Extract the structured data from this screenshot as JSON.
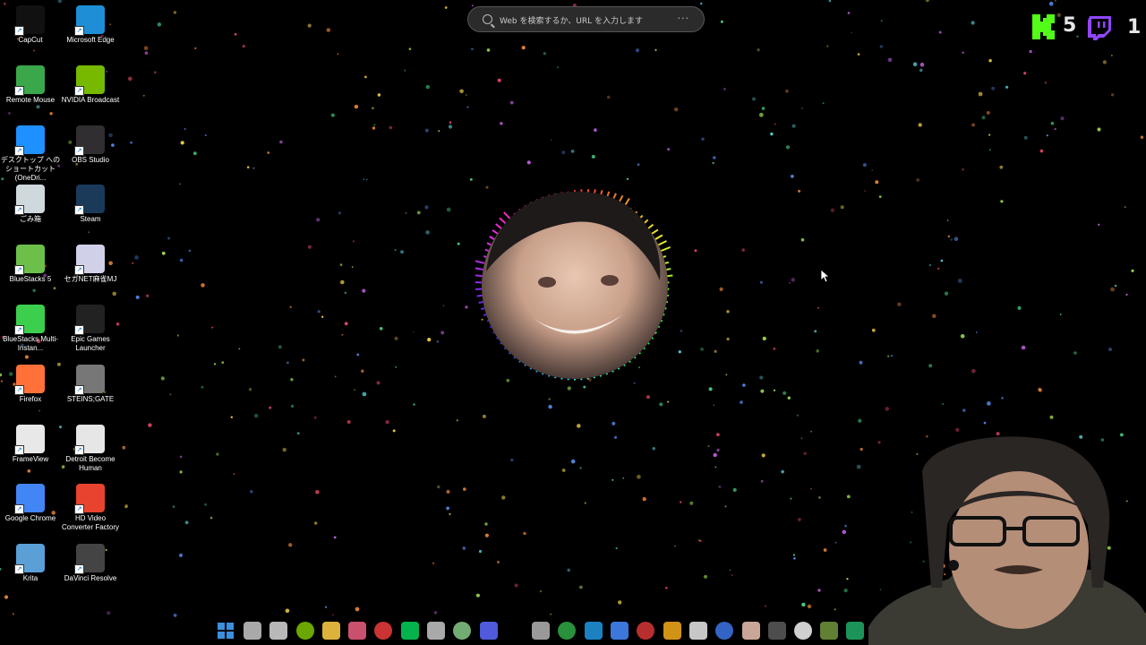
{
  "desktop": {
    "icons": [
      {
        "label": "CapCut",
        "icon": "capcut-icon",
        "color": "#111111"
      },
      {
        "label": "Microsoft Edge",
        "icon": "edge-icon",
        "color": "#1e8fd6"
      },
      {
        "label": "Remote Mouse",
        "icon": "remote-mouse-icon",
        "color": "#3aa84a"
      },
      {
        "label": "NVIDIA Broadcast",
        "icon": "nvidia-broadcast-icon",
        "color": "#76b900"
      },
      {
        "label": "デスクトップ へのショートカット (OneDri...",
        "icon": "onedrive-icon",
        "color": "#1e90ff"
      },
      {
        "label": "OBS Studio",
        "icon": "obs-icon",
        "color": "#302e31"
      },
      {
        "label": "ごみ箱",
        "icon": "recycle-bin-icon",
        "color": "#cfd8dc"
      },
      {
        "label": "Steam",
        "icon": "steam-icon",
        "color": "#1b3a5a"
      },
      {
        "label": "BlueStacks 5",
        "icon": "bluestacks-icon",
        "color": "#6cc04a"
      },
      {
        "label": "セガNET麻雀MJ",
        "icon": "sega-mj-icon",
        "color": "#d0d0e8"
      },
      {
        "label": "BlueStacks Multi-Instan...",
        "icon": "bluestacks-multi-icon",
        "color": "#3ccf4e"
      },
      {
        "label": "Epic Games Launcher",
        "icon": "epic-games-icon",
        "color": "#222222"
      },
      {
        "label": "Firefox",
        "icon": "firefox-icon",
        "color": "#ff7139"
      },
      {
        "label": "STEINS;GATE",
        "icon": "steins-gate-icon",
        "color": "#777777"
      },
      {
        "label": "FrameView",
        "icon": "frameview-icon",
        "color": "#e8e8e8"
      },
      {
        "label": "Detroit Become Human",
        "icon": "detroit-icon",
        "color": "#e6e6e6"
      },
      {
        "label": "Google Chrome",
        "icon": "chrome-icon",
        "color": "#4285f4"
      },
      {
        "label": "HD Video Converter Factory",
        "icon": "hd-video-converter-icon",
        "color": "#e8432e"
      },
      {
        "label": "Krita",
        "icon": "krita-icon",
        "color": "#5a9fd6"
      },
      {
        "label": "DaVinci Resolve",
        "icon": "davinci-resolve-icon",
        "color": "#444444"
      }
    ]
  },
  "search": {
    "placeholder": "Web を検索するか、URL を入力します",
    "more": "···"
  },
  "overlay": {
    "kick_count": "5",
    "twitch_count": "1",
    "kick_color": "#53fc18",
    "twitch_color": "#9146ff"
  },
  "taskbar": {
    "items": [
      {
        "name": "start-icon",
        "color": "#3a8fde"
      },
      {
        "name": "task-view-icon",
        "color": "#bbbbbb"
      },
      {
        "name": "obs-taskbar-icon",
        "color": "#cccccc"
      },
      {
        "name": "nvidia-taskbar-icon",
        "color": "#76b900"
      },
      {
        "name": "file-explorer-icon",
        "color": "#f4c542"
      },
      {
        "name": "lips-app-icon",
        "color": "#e05a7a"
      },
      {
        "name": "record-app-icon",
        "color": "#e03a3a"
      },
      {
        "name": "line-app-icon",
        "color": "#06c755"
      },
      {
        "name": "translate-app-icon",
        "color": "#bbbbbb"
      },
      {
        "name": "vim-app-icon",
        "color": "#7fbf7f"
      },
      {
        "name": "discord-icon",
        "color": "#5865f2"
      },
      {
        "name": "store-icon",
        "color": "#aaaaaa"
      },
      {
        "name": "xbox-icon",
        "color": "#2ea043"
      },
      {
        "name": "edge-taskbar-icon",
        "color": "#1e8fd6"
      },
      {
        "name": "chrome-taskbar-icon",
        "color": "#4285f4"
      },
      {
        "name": "msi-app-icon",
        "color": "#cc3333"
      },
      {
        "name": "coin-app-icon",
        "color": "#e8a317"
      },
      {
        "name": "capcut-taskbar-icon",
        "color": "#dddddd"
      },
      {
        "name": "outlook-icon",
        "color": "#3a6fd8"
      },
      {
        "name": "photo-app-icon",
        "color": "#e0b8a8"
      },
      {
        "name": "gear-taskbar-icon",
        "color": "#555555"
      },
      {
        "name": "samsung-app-icon",
        "color": "#e6e6e6"
      },
      {
        "name": "minecraft-icon",
        "color": "#6b8e3a"
      },
      {
        "name": "sheets-app-icon",
        "color": "#1fa463"
      }
    ]
  }
}
